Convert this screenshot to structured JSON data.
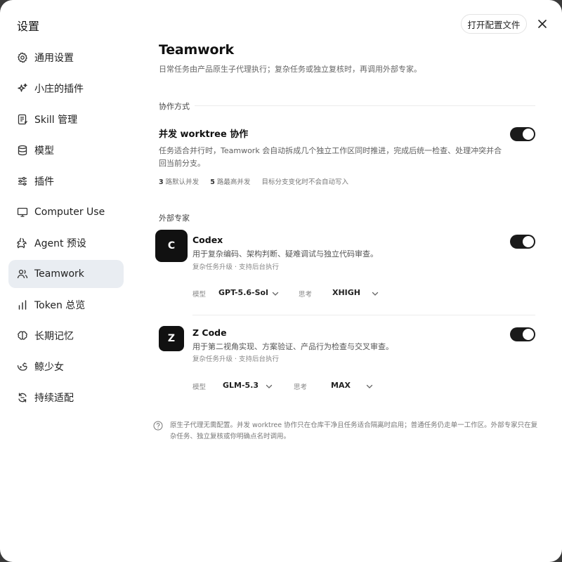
{
  "window": {
    "title": "设置",
    "open_config_label": "打开配置文件"
  },
  "sidebar": {
    "items": [
      {
        "label": "通用设置",
        "icon": "gear-icon"
      },
      {
        "label": "小庄的插件",
        "icon": "sparkle-icon"
      },
      {
        "label": "Skill 管理",
        "icon": "skill-doc-icon"
      },
      {
        "label": "模型",
        "icon": "database-icon"
      },
      {
        "label": "插件",
        "icon": "sliders-icon"
      },
      {
        "label": "Computer Use",
        "icon": "monitor-icon"
      },
      {
        "label": "Agent 预设",
        "icon": "agent-icon"
      },
      {
        "label": "Teamwork",
        "icon": "users-icon",
        "active": true
      },
      {
        "label": "Token 总览",
        "icon": "bar-chart-icon"
      },
      {
        "label": "长期记忆",
        "icon": "brain-icon"
      },
      {
        "label": "鲸少女",
        "icon": "whale-icon"
      },
      {
        "label": "持续适配",
        "icon": "refresh-icon"
      }
    ]
  },
  "main": {
    "title": "Teamwork",
    "subtitle": "日常任务由产品原生子代理执行；复杂任务或独立复核时，再调用外部专家。",
    "collab_section": "协作方式",
    "worktree": {
      "title": "并发 worktree 协作",
      "desc": "任务适合并行时，Teamwork 会自动拆成几个独立工作区同时推进，完成后统一检查、处理冲突并合回当前分支。",
      "enabled": true,
      "meta1_num": "3",
      "meta1_text": "路默认并发",
      "meta2_num": "5",
      "meta2_text": "路最高并发",
      "meta3_text": "目标分支变化时不会自动写入"
    },
    "experts_section": "外部专家",
    "experts": [
      {
        "avatar": "C",
        "name": "Codex",
        "desc": "用于复杂编码、架构判断、疑难调试与独立代码审查。",
        "sub": "复杂任务升级 · 支持后台执行",
        "enabled": true,
        "model_label": "模型",
        "model_value": "GPT-5.6-Sol",
        "think_label": "思考",
        "think_value": "XHIGH"
      },
      {
        "avatar": "Z",
        "name": "Z Code",
        "desc": "用于第二视角实现、方案验证、产品行为检查与交叉审查。",
        "sub": "复杂任务升级 · 支持后台执行",
        "enabled": true,
        "model_label": "模型",
        "model_value": "GLM-5.3",
        "think_label": "思考",
        "think_value": "MAX"
      }
    ],
    "note": "原生子代理无需配置。并发 worktree 协作只在仓库干净且任务适合隔离时启用；普通任务仍走单一工作区。外部专家只在复杂任务、独立复核或你明确点名时调用。"
  },
  "colors": {
    "active_bg": "#e9edf2",
    "toggle_on": "#1a1a1a",
    "avatar_bg": "#111111"
  }
}
